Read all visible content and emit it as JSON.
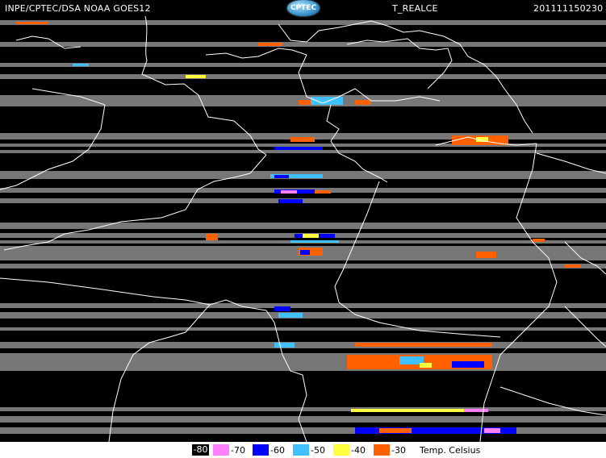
{
  "header": {
    "source": "INPE/CPTEC/DSA NOAA GOES12",
    "product": "T_REALCE",
    "timestamp": "201111150230",
    "logo_text": "CPTEC"
  },
  "legend": {
    "title": "Temp. Celsius",
    "items": [
      {
        "label": "-80",
        "color": "#000000",
        "text_color": "#ffffff"
      },
      {
        "label": "-70",
        "color": "#ff80ff",
        "text_color": "#000000"
      },
      {
        "label": "-60",
        "color": "#0000ff",
        "text_color": "#ffffff"
      },
      {
        "label": "-50",
        "color": "#40c0ff",
        "text_color": "#000000"
      },
      {
        "label": "-40",
        "color": "#ffff40",
        "text_color": "#000000"
      },
      {
        "label": "-30",
        "color": "#ff6000",
        "text_color": "#000000"
      }
    ]
  },
  "colors": {
    "background": "#000000",
    "borders": "#ffffff",
    "cloud_gray": "#8a8a8a"
  }
}
